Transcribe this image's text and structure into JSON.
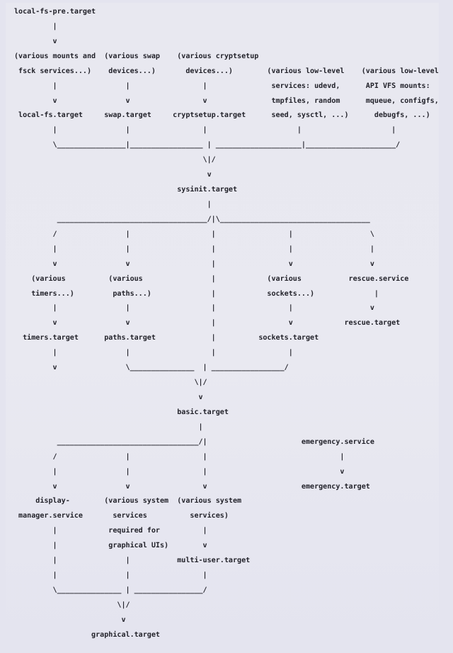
{
  "document": {
    "kind": "ascii-diagram",
    "title": "systemd bootup target dependency diagram",
    "background_color": "#e4e4ef",
    "text_color": "#22222a"
  },
  "nodes": {
    "targets": [
      "local-fs-pre.target",
      "local-fs.target",
      "swap.target",
      "cryptsetup.target",
      "sysinit.target",
      "timers.target",
      "paths.target",
      "sockets.target",
      "rescue.target",
      "basic.target",
      "emergency.target",
      "multi-user.target",
      "graphical.target"
    ],
    "services": [
      "rescue.service",
      "emergency.service",
      "display-manager.service"
    ],
    "groups": [
      "(various mounts and fsck services...)",
      "(various swap devices...)",
      "(various cryptsetup devices...)",
      "(various low-level services: udevd, tmpfiles, random seed, sysctl, ...)",
      "(various low-level API VFS mounts: mqueue, configfs, debugfs, ...)",
      "(various timers...)",
      "(various paths...)",
      "(various sockets...)",
      "(various system services required for graphical UIs)",
      "(various system services)"
    ]
  },
  "ascii": {
    "lines": [
      "local-fs-pre.target",
      "         |",
      "         v",
      "(various mounts and  (various swap    (various cryptsetup",
      " fsck services...)    devices...)       devices...)        (various low-level    (various low-level",
      "         |                |                 |               services: udevd,      API VFS mounts:",
      "         v                v                 v               tmpfiles, random      mqueue, configfs,",
      " local-fs.target     swap.target     cryptsetup.target      seed, sysctl, ...)      debugfs, ...)",
      "         |                |                 |                     |                     |",
      "         \\________________|_________________ | ____________________|_____________________/",
      "                                            \\|/",
      "                                             v",
      "                                      sysinit.target",
      "                                             |",
      "          ___________________________________/|\\___________________________________",
      "         /                |                   |                 |                  \\",
      "         |                |                   |                 |                  |",
      "         v                v                   |                 v                  v",
      "    (various          (various                |            (various           rescue.service",
      "    timers...)         paths...)              |            sockets...)              |",
      "         |                |                   |                 |                  v",
      "         v                v                   |                 v            rescue.target",
      "  timers.target      paths.target             |          sockets.target",
      "         |                |                   |                 |",
      "         v                \\_______________  | _________________/",
      "                                          \\|/",
      "                                           v",
      "                                      basic.target",
      "                                           |",
      "          _________________________________/|                      emergency.service",
      "         /                |                 |                               |",
      "         |                |                 |                               v",
      "         v                v                 v                      emergency.target",
      "     display-        (various system  (various system",
      " manager.service       services          services)",
      "         |            required for          |",
      "         |            graphical UIs)        v",
      "         |                |           multi-user.target",
      "         |                |                 |",
      "         \\_______________ | ________________/",
      "                        \\|/",
      "                         v",
      "                  graphical.target"
    ]
  },
  "edges": [
    {
      "from": "local-fs-pre.target",
      "to": "(various mounts and fsck services...)"
    },
    {
      "from": "(various mounts and fsck services...)",
      "to": "local-fs.target"
    },
    {
      "from": "(various swap devices...)",
      "to": "swap.target"
    },
    {
      "from": "(various cryptsetup devices...)",
      "to": "cryptsetup.target"
    },
    {
      "from": "local-fs.target",
      "to": "sysinit.target"
    },
    {
      "from": "swap.target",
      "to": "sysinit.target"
    },
    {
      "from": "cryptsetup.target",
      "to": "sysinit.target"
    },
    {
      "from": "(various low-level services: udevd, tmpfiles, random seed, sysctl, ...)",
      "to": "sysinit.target"
    },
    {
      "from": "(various low-level API VFS mounts: mqueue, configfs, debugfs, ...)",
      "to": "sysinit.target"
    },
    {
      "from": "sysinit.target",
      "to": "(various timers...)"
    },
    {
      "from": "sysinit.target",
      "to": "(various paths...)"
    },
    {
      "from": "sysinit.target",
      "to": "(various sockets...)"
    },
    {
      "from": "sysinit.target",
      "to": "rescue.service"
    },
    {
      "from": "sysinit.target",
      "to": "basic.target"
    },
    {
      "from": "(various timers...)",
      "to": "timers.target"
    },
    {
      "from": "(various paths...)",
      "to": "paths.target"
    },
    {
      "from": "(various sockets...)",
      "to": "sockets.target"
    },
    {
      "from": "rescue.service",
      "to": "rescue.target"
    },
    {
      "from": "paths.target",
      "to": "basic.target"
    },
    {
      "from": "sockets.target",
      "to": "basic.target"
    },
    {
      "from": "basic.target",
      "to": "display-manager.service"
    },
    {
      "from": "basic.target",
      "to": "(various system services required for graphical UIs)"
    },
    {
      "from": "basic.target",
      "to": "(various system services)"
    },
    {
      "from": "emergency.service",
      "to": "emergency.target"
    },
    {
      "from": "(various system services)",
      "to": "multi-user.target"
    },
    {
      "from": "display-manager.service",
      "to": "graphical.target"
    },
    {
      "from": "(various system services required for graphical UIs)",
      "to": "graphical.target"
    },
    {
      "from": "multi-user.target",
      "to": "graphical.target"
    }
  ]
}
